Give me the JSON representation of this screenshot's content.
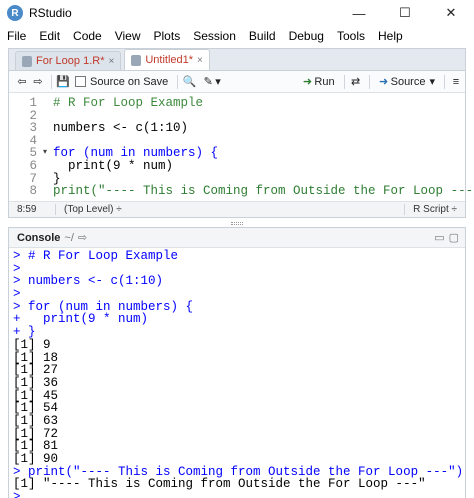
{
  "window": {
    "title": "RStudio",
    "logo_letter": "R",
    "controls": {
      "minimize": "—",
      "maximize": "☐",
      "close": "✕"
    }
  },
  "menu": [
    "File",
    "Edit",
    "Code",
    "View",
    "Plots",
    "Session",
    "Build",
    "Debug",
    "Tools",
    "Help"
  ],
  "editor": {
    "tabs": [
      {
        "label": "For Loop 1.R*",
        "close": "×"
      },
      {
        "label": "Untitled1*",
        "close": "×"
      }
    ],
    "toolbar": {
      "back": "⇦",
      "forward": "⇨",
      "save_icon": "💾",
      "source_on_save_label": "Source on Save",
      "search_icon": "🔍",
      "wand_icon": "✎",
      "wand_caret": "▾",
      "run_label": "Run",
      "rerun_icon": "⇄",
      "source_label": "Source",
      "source_caret": "▾",
      "outline_icon": "≡"
    },
    "lines": [
      {
        "n": "1",
        "text": "# R For Loop Example"
      },
      {
        "n": "2",
        "text": ""
      },
      {
        "n": "3",
        "text": "numbers <- c(1:10)"
      },
      {
        "n": "4",
        "text": ""
      },
      {
        "n": "5",
        "text": "for (num in numbers) {"
      },
      {
        "n": "6",
        "text": "  print(9 * num)"
      },
      {
        "n": "7",
        "text": "}"
      },
      {
        "n": "8",
        "text": "print(\"---- This is Coming from Outside the For Loop ---\")"
      }
    ],
    "fold_marker": "▾",
    "status": {
      "position": "8:59",
      "scope": "(Top Level) ÷",
      "file_type": "R Script ÷"
    }
  },
  "console": {
    "title": "Console",
    "path": "~/",
    "path_icon": "⇨",
    "header_icons": {
      "minimize": "▭",
      "maximize": "▢"
    },
    "lines": [
      {
        "kind": "input",
        "text": "> # R For Loop Example"
      },
      {
        "kind": "input",
        "text": ">"
      },
      {
        "kind": "input",
        "text": "> numbers <- c(1:10)"
      },
      {
        "kind": "input",
        "text": ">"
      },
      {
        "kind": "input",
        "text": "> for (num in numbers) {"
      },
      {
        "kind": "input",
        "text": "+   print(9 * num)"
      },
      {
        "kind": "input",
        "text": "+ }"
      },
      {
        "kind": "output",
        "text": "[1] 9"
      },
      {
        "kind": "output",
        "text": "[1] 18"
      },
      {
        "kind": "output",
        "text": "[1] 27"
      },
      {
        "kind": "output",
        "text": "[1] 36"
      },
      {
        "kind": "output",
        "text": "[1] 45"
      },
      {
        "kind": "output",
        "text": "[1] 54"
      },
      {
        "kind": "output",
        "text": "[1] 63"
      },
      {
        "kind": "output",
        "text": "[1] 72"
      },
      {
        "kind": "output",
        "text": "[1] 81"
      },
      {
        "kind": "output",
        "text": "[1] 90"
      },
      {
        "kind": "input",
        "text": "> print(\"---- This is Coming from Outside the For Loop ---\")"
      },
      {
        "kind": "output",
        "text": "[1] \"---- This is Coming from Outside the For Loop ---\""
      },
      {
        "kind": "input",
        "text": ">"
      }
    ]
  },
  "colors": {
    "comment": "#3c8a3c",
    "keyword": "#0000ff",
    "string": "#2e7d32",
    "console_input": "#0000ff",
    "tab_modified": "#c0392b"
  }
}
